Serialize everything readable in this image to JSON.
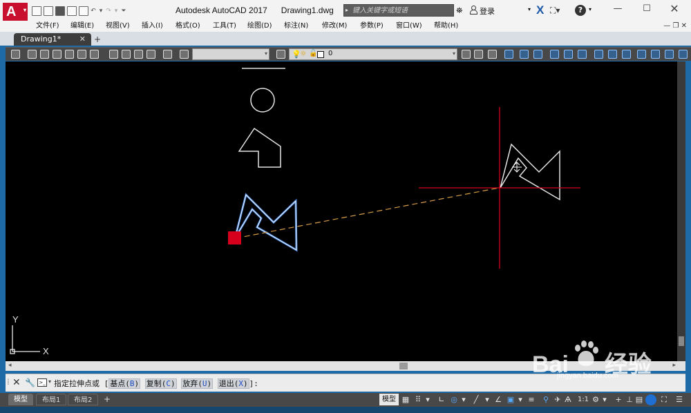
{
  "titlebar": {
    "app_name": "Autodesk AutoCAD 2017",
    "file_name": "Drawing1.dwg",
    "search_placeholder": "键入关键字或短语",
    "login_label": "登录",
    "help_label": "?",
    "logo_letter": "A",
    "window_controls": {
      "minimize": "—",
      "maximize": "☐",
      "close": "✕"
    }
  },
  "menubar": {
    "items": [
      "文件(F)",
      "编辑(E)",
      "视图(V)",
      "插入(I)",
      "格式(O)",
      "工具(T)",
      "绘图(D)",
      "标注(N)",
      "修改(M)",
      "参数(P)",
      "窗口(W)",
      "帮助(H)"
    ],
    "mdi_controls": "— ❐ ✕"
  },
  "doc_tabs": {
    "active": "Drawing1*",
    "close": "✕",
    "add": "+"
  },
  "toolbar": {
    "layer_name": "0",
    "layer_color": "#ffffff",
    "icons": [
      "layer-properties-icon",
      "layer-state-icon",
      "match-properties-icon",
      "dimension-icon",
      "quick-dim-icon",
      "linear-dim-icon"
    ]
  },
  "canvas": {
    "background": "#000000",
    "crosshair_color": "#d6001c",
    "rubberband_color": "#d89e4a",
    "grip_color": "#d6001c",
    "selected_color": "#4d8ff0",
    "ucs_x": "X",
    "ucs_y": "Y"
  },
  "command_line": {
    "prefix": "指定拉伸点或 [",
    "options": [
      {
        "label": "基点(",
        "key": "B",
        "end": ")"
      },
      {
        "label": "复制(",
        "key": "C",
        "end": ")"
      },
      {
        "label": "放弃(",
        "key": "U",
        "end": ")"
      },
      {
        "label": "退出(",
        "key": "X",
        "end": ")"
      }
    ],
    "suffix": "]:"
  },
  "status_bar": {
    "layout_tabs": [
      "模型",
      "布局1",
      "布局2"
    ],
    "add_tab": "+",
    "model_button": "模型",
    "scale": "1:1",
    "icons": [
      "grid-icon",
      "snap-icon",
      "ortho-icon",
      "polar-icon",
      "isodraft-icon",
      "osnap-icon",
      "otrack-icon",
      "lineweight-icon",
      "transparency-icon",
      "annotation-scale-icon",
      "workspace-icon",
      "plus-icon",
      "units-icon",
      "quick-props-icon",
      "isolate-icon",
      "fullscreen-icon",
      "customize-icon"
    ]
  },
  "watermark": {
    "brand": "Bai",
    "brand_tail": "经验",
    "url": "jingyan.baidu.com"
  }
}
